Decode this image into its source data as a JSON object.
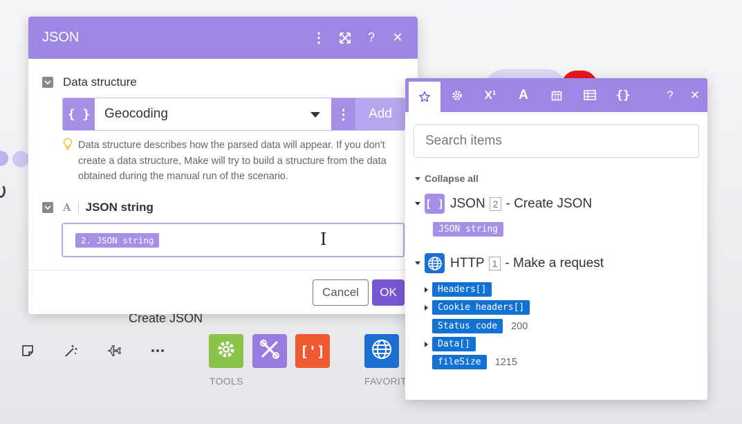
{
  "canvas": {
    "module_label": "Create JSON",
    "tiles": [
      {
        "label": "TOOLS"
      },
      {
        "label": "FAVORIT"
      }
    ],
    "toolbar_icons": [
      "note-icon",
      "magic-wand-icon",
      "airplane-icon",
      "ellipsis-icon"
    ]
  },
  "dialog": {
    "title": "JSON",
    "header_buttons": [
      "more-icon",
      "expand-icon",
      "help-icon",
      "close-icon"
    ],
    "data_structure": {
      "label": "Data structure",
      "selected": "Geocoding",
      "add_label": "Add",
      "hint": "Data structure describes how the parsed data will appear. If you don't create a data structure, Make will try to build a structure from the data obtained during the manual run of the scenario."
    },
    "json_string": {
      "type_glyph": "A",
      "label": "JSON string",
      "value_pill": "2. JSON string"
    },
    "footer": {
      "cancel": "Cancel",
      "ok": "OK"
    }
  },
  "panel": {
    "tabs": [
      "star-icon",
      "gear-icon",
      "superscript-icon",
      "text-icon",
      "calendar-icon",
      "table-icon",
      "braces-icon"
    ],
    "help": "?",
    "close": "✕",
    "search_placeholder": "Search items",
    "collapse_all": "Collapse all",
    "modules": [
      {
        "name": "JSON",
        "number": "2",
        "suffix": "- Create JSON",
        "items": [
          {
            "label": "JSON string"
          }
        ]
      },
      {
        "name": "HTTP",
        "number": "1",
        "suffix": "- Make a request",
        "items": [
          {
            "label": "Headers[]",
            "expandable": true,
            "value": ""
          },
          {
            "label": "Cookie headers[]",
            "expandable": true,
            "value": ""
          },
          {
            "label": "Status code",
            "expandable": false,
            "value": "200"
          },
          {
            "label": "Data[]",
            "expandable": true,
            "value": ""
          },
          {
            "label": "fileSize",
            "expandable": false,
            "value": "1215"
          }
        ]
      }
    ]
  },
  "colors": {
    "header_purple": "#9d86e4",
    "ok_purple": "#7a56d4",
    "pill_blue": "#1271d4",
    "tools_green": "#8bc34a",
    "json_orange": "#ef5a33",
    "http_blue": "#1b6fd3"
  }
}
